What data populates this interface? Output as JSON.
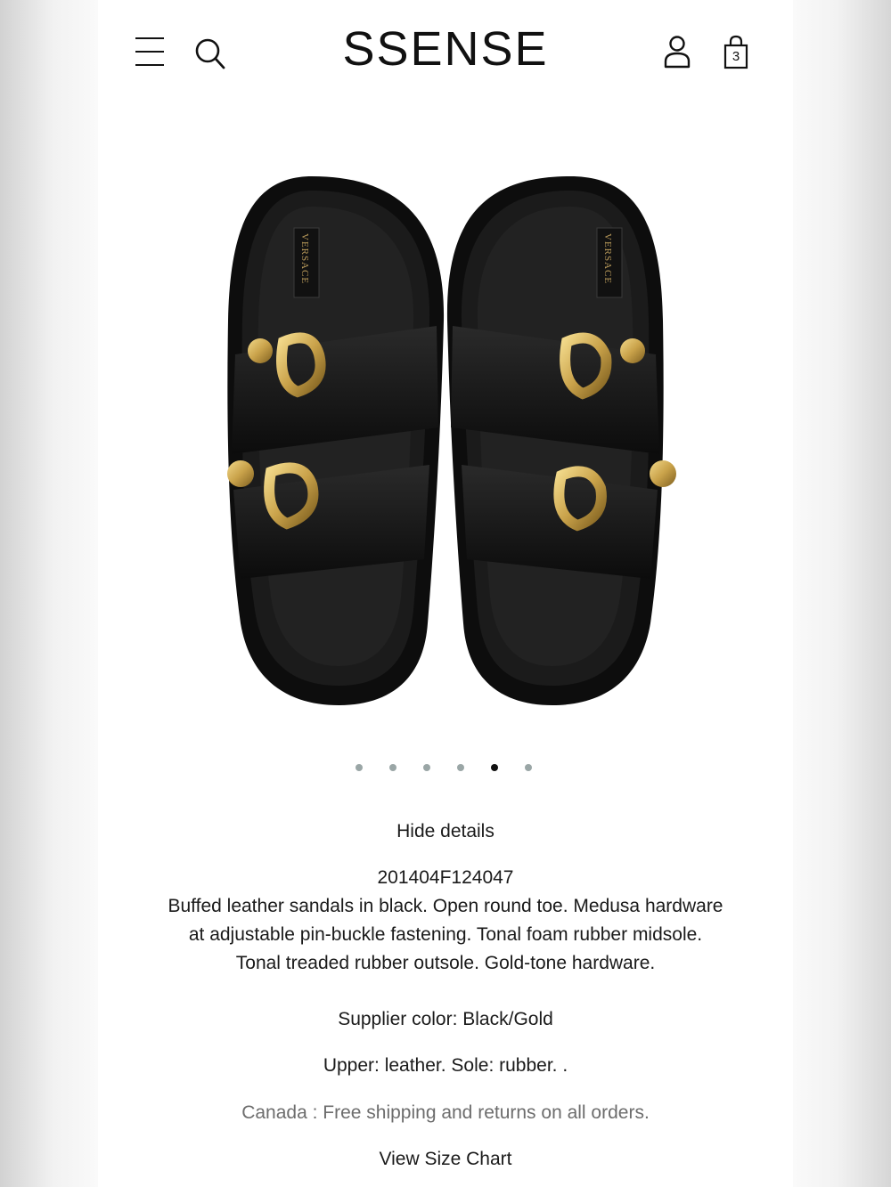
{
  "header": {
    "logo": "SSENSE",
    "menu_icon": "hamburger-menu-icon",
    "search_icon": "search-icon",
    "account_icon": "user-icon",
    "bag_icon": "shopping-bag-icon",
    "bag_count": "3"
  },
  "product": {
    "image": {
      "subject": "black leather double-buckle slide sandals with gold baroque buckles",
      "insole_label": "VERSACE",
      "colors": {
        "leather": "#141414",
        "buckle": "#c9a24a",
        "background": "#ffffff"
      }
    },
    "carousel": {
      "total": 6,
      "active_index": 4,
      "dot_color": "#9aa6a6",
      "active_dot_color": "#111111"
    },
    "hide_details_label": "Hide details",
    "sku": "201404F124047",
    "description_lines": [
      "Buffed leather sandals in black. Open round toe. Medusa hardware",
      "at adjustable pin-buckle fastening. Tonal foam rubber midsole.",
      "Tonal treaded rubber outsole. Gold-tone hardware."
    ],
    "supplier_color": "Supplier color: Black/Gold",
    "composition": "Upper: leather. Sole: rubber. .",
    "shipping_note": "Canada : Free shipping and returns on all orders.",
    "size_chart_label": "View Size Chart"
  }
}
